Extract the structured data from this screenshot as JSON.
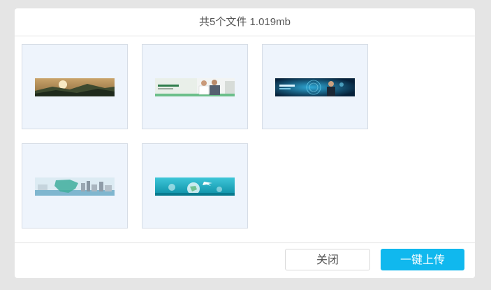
{
  "dialog": {
    "title": "共5个文件 1.019mb"
  },
  "files": [
    {
      "preview": "mountain-sunset-banner-image"
    },
    {
      "preview": "business-people-banner-image"
    },
    {
      "preview": "tech-blue-banner-image"
    },
    {
      "preview": "map-city-banner-image"
    },
    {
      "preview": "travel-globe-banner-image"
    }
  ],
  "footer": {
    "close_label": "关闭",
    "upload_label": "一键上传"
  },
  "colors": {
    "primary": "#10b8ee",
    "thumb_bg": "#eef4fc",
    "page_bg": "#e5e5e5"
  }
}
